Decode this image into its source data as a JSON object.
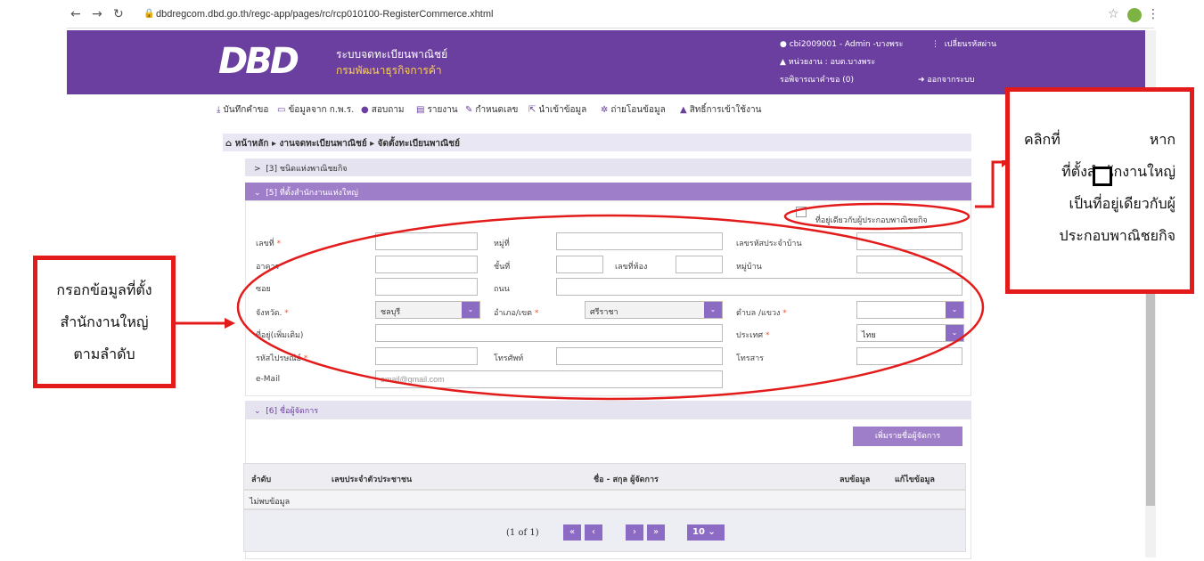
{
  "browser": {
    "url": "dbdregcom.dbd.go.th/regc-app/pages/rc/rcp010100-RegisterCommerce.xhtml"
  },
  "header": {
    "logo_text": "DBD",
    "system_name": "ระบบจดทะเบียนพาณิชย์",
    "department": "กรมพัฒนาธุรกิจการค้า",
    "user": "cbi2009001 - Admin -บางพระ",
    "change_password": "เปลี่ยนรหัสผ่าน",
    "unit": "หน่วยงาน : อบต.บางพระ",
    "pending": "รอพิจารณาคำขอ (0)",
    "logout": "ออกจากระบบ"
  },
  "toolbar": {
    "items": [
      "บันทึกคำขอ",
      "ข้อมูลจาก ก.พ.ร.",
      "สอบถาม",
      "รายงาน",
      "กำหนดเลข",
      "นำเข้าข้อมูล",
      "ถ่ายโอนข้อมูล",
      "สิทธิ์การเข้าใช้งาน"
    ]
  },
  "breadcrumb": "หน้าหลัก ▸ งานจดทะเบียนพาณิชย์ ▸ จัดตั้งทะเบียนพาณิชย์",
  "sections": {
    "s3": "[3] ชนิดแห่งพาณิชยกิจ",
    "s5": "[5] ที่ตั้งสำนักงานแห่งใหญ่",
    "s6": "[6] ชื่อผู้จัดการ"
  },
  "form": {
    "same_address": "ที่อยู่เดียวกับผู้ประกอบพาณิชยกิจ",
    "labels": {
      "house_no": "เลขที่",
      "moo": "หมู่ที่",
      "house_id": "เลขรหัสประจำบ้าน",
      "building": "อาคาร",
      "floor": "ชั้นที่",
      "room": "เลขที่ห้อง",
      "village": "หมู่บ้าน",
      "soi": "ซอย",
      "road": "ถนน",
      "province": "จังหวัด.",
      "district": "อำเภอ/เขต",
      "subdistrict": "ตำบล /แขวง",
      "address_more": "ที่อยู่(เพิ่มเติม)",
      "country": "ประเทศ",
      "postcode": "รหัสไปรษณีย์",
      "phone": "โทรศัพท์",
      "fax": "โทรสาร",
      "email": "e-Mail"
    },
    "values": {
      "province": "ชลบุรี",
      "district": "ศรีราชา",
      "country": "ไทย"
    },
    "email_placeholder": "email@gmail.com"
  },
  "managers": {
    "add_button": "เพิ่มรายชื่อผู้จัดการ",
    "columns": [
      "ลำดับ",
      "เลขประจำตัวประชาชน",
      "ชื่อ - สกุล ผู้จัดการ",
      "ลบข้อมูล",
      "แก้ไขข้อมูล"
    ],
    "empty": "ไม่พบข้อมูล",
    "page_info": "(1 of 1)",
    "page_size": "10"
  },
  "annotations": {
    "left": [
      "กรอกข้อมูลที่ตั้ง",
      "สำนักงานใหญ่",
      "ตามลำดับ"
    ],
    "right": [
      "คลิกที่",
      "หาก",
      "ที่ตั้งสำนักงานใหญ่",
      "เป็นที่อยู่เดียวกับผู้",
      "ประกอบพาณิชยกิจ"
    ]
  },
  "colors": {
    "header": "#6b3fa0",
    "accent": "#8c6bc4",
    "annotation": "#e31b1b"
  }
}
